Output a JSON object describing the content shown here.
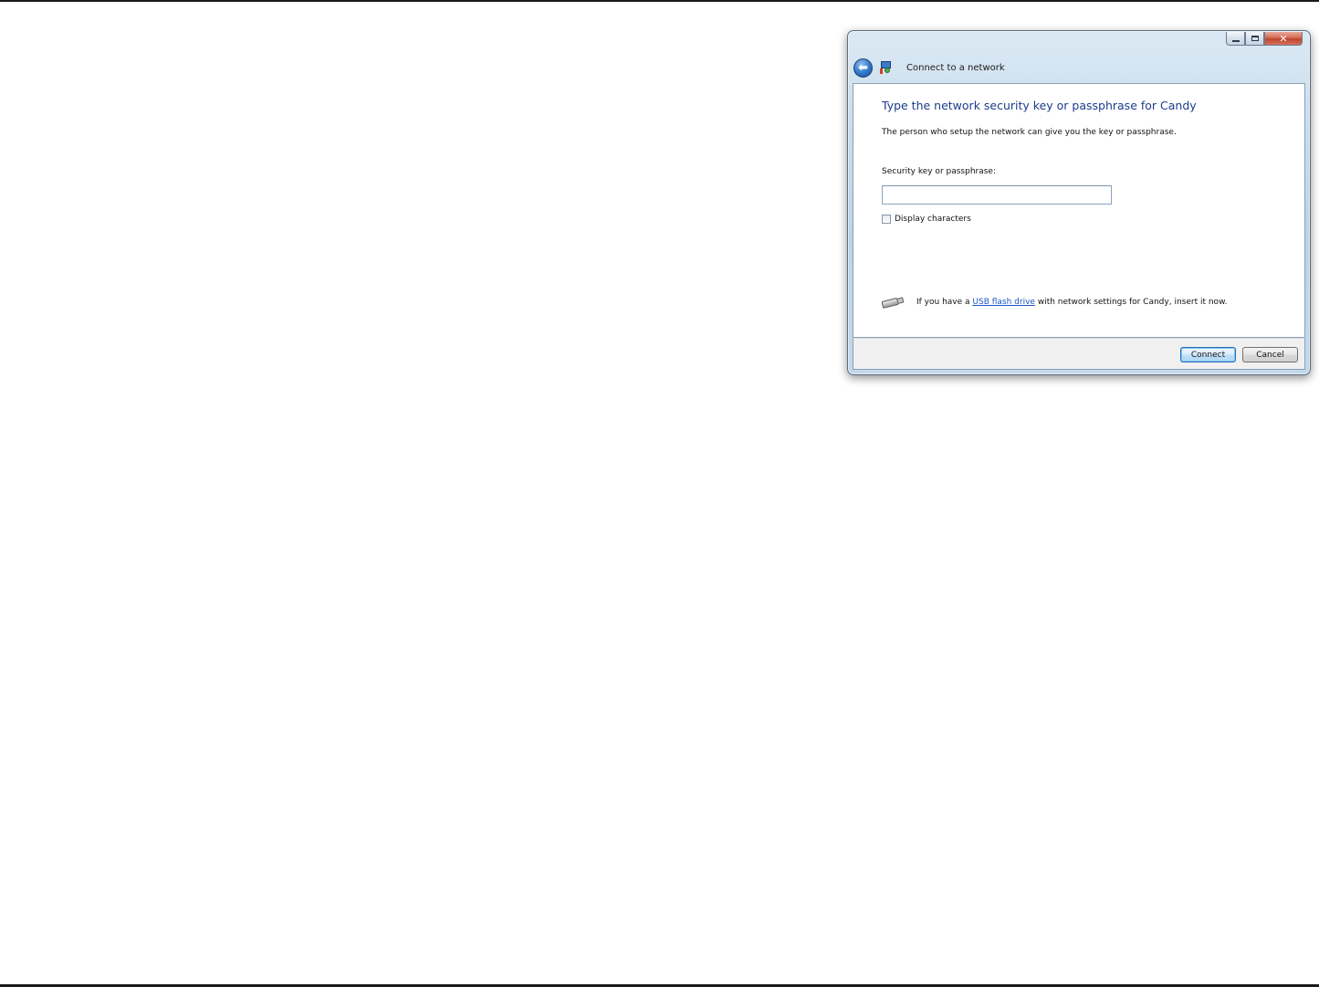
{
  "window": {
    "title": "Connect to a network",
    "controls": {
      "minimize_icon": "minimize-icon",
      "maximize_icon": "maximize-icon",
      "close_glyph": "✕"
    }
  },
  "nav": {
    "back_icon": "back-arrow-icon",
    "back_glyph": "⬅",
    "network_icon": "network-connect-icon"
  },
  "content": {
    "heading": "Type the network security key or passphrase for Candy",
    "description": "The person who setup the network can give you the key or passphrase.",
    "key_label": "Security key or passphrase:",
    "key_value": "",
    "key_placeholder": "",
    "display_characters_label": "Display characters",
    "display_characters_checked": false,
    "usb_icon": "usb-flash-drive-icon",
    "usb_prefix": "If you have a ",
    "usb_link": "USB flash drive",
    "usb_suffix": " with network settings for Candy, insert it now."
  },
  "footer": {
    "connect_label": "Connect",
    "cancel_label": "Cancel"
  },
  "colors": {
    "heading": "#1c3c8c",
    "link": "#1a58c2",
    "window_glass": "#c9dcec",
    "close_button": "#c0442d"
  }
}
